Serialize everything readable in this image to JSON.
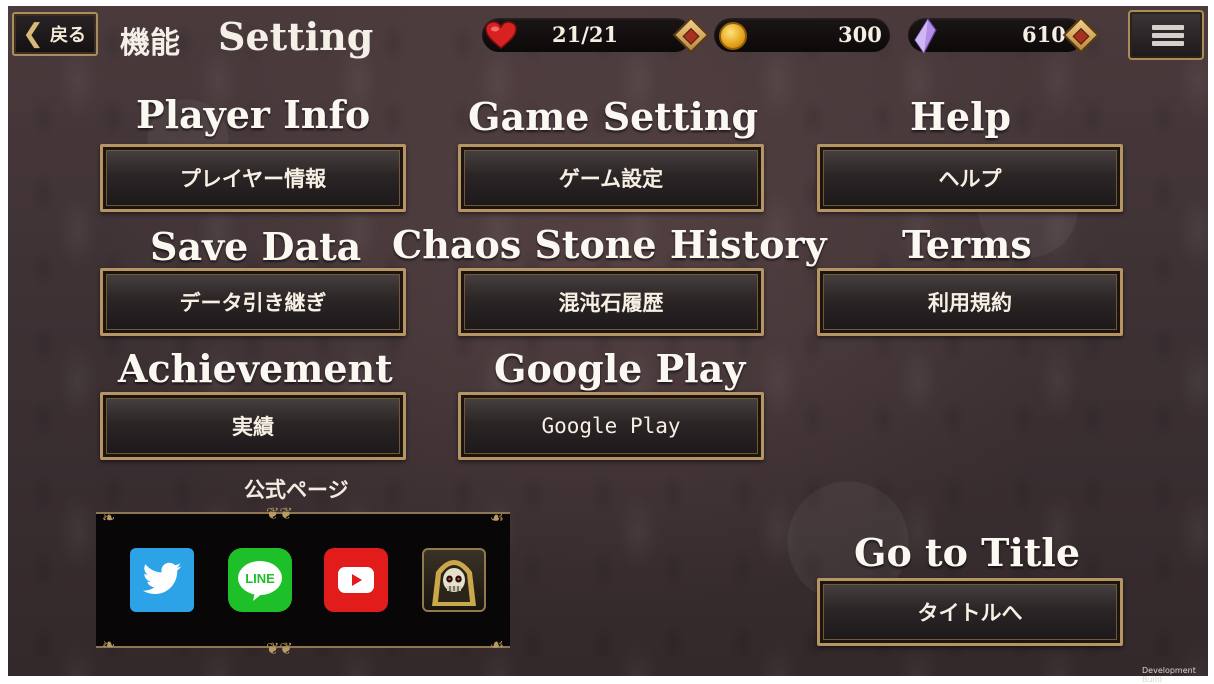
{
  "header": {
    "back_label": "戻る",
    "title_ja": "機能",
    "title_en": "Setting",
    "stamina": "21/21",
    "gold": "300",
    "chaos_stones": "610",
    "icons": [
      "heart-icon",
      "coin-icon",
      "crystal-icon",
      "menu-icon"
    ]
  },
  "sections": {
    "player_info": {
      "title": "Player Info",
      "button": "プレイヤー情報"
    },
    "game_setting": {
      "title": "Game Setting",
      "button": "ゲーム設定"
    },
    "help": {
      "title": "Help",
      "button": "ヘルプ"
    },
    "save_data": {
      "title": "Save Data",
      "button": "データ引き継ぎ"
    },
    "chaos_stone_history": {
      "title": "Chaos Stone History",
      "button": "混沌石履歴"
    },
    "terms": {
      "title": "Terms",
      "button": "利用規約"
    },
    "achievement": {
      "title": "Achievement",
      "button": "実績"
    },
    "google_play": {
      "title": "Google Play",
      "button": "Google Play"
    },
    "go_to_title": {
      "title": "Go to Title",
      "button": "タイトルへ"
    }
  },
  "official": {
    "label": "公式ページ",
    "links": [
      {
        "name": "Twitter",
        "color": "#2da3e7"
      },
      {
        "name": "LINE",
        "label": "LINE",
        "color": "#1ec02a"
      },
      {
        "name": "YouTube",
        "color": "#e21b1b"
      },
      {
        "name": "Overlord"
      }
    ]
  },
  "footer": {
    "dev_build": "Development Build"
  },
  "colors": {
    "button_border": "#b49563",
    "background": "#3d3134",
    "text": "#f6f0e4"
  }
}
